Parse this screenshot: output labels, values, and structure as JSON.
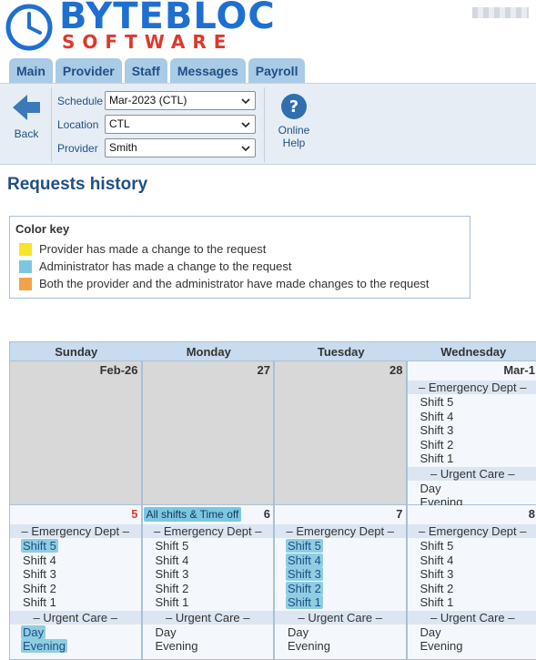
{
  "logo": {
    "top": "BYTEBLOC",
    "bottom": "SOFTWARE"
  },
  "tabs": [
    "Main",
    "Provider",
    "Staff",
    "Messages",
    "Payroll"
  ],
  "toolbar": {
    "back_label": "Back",
    "help_label_1": "Online",
    "help_label_2": "Help",
    "schedule_label": "Schedule",
    "schedule_value": "Mar-2023 (CTL)",
    "location_label": "Location",
    "location_value": "CTL",
    "provider_label": "Provider",
    "provider_value": "Smith"
  },
  "page_title": "Requests history",
  "color_key": {
    "title": "Color key",
    "items": [
      {
        "label": "Provider has made a change to the request",
        "color": "#f7e52a"
      },
      {
        "label": "Administrator has made a change to the request",
        "color": "#7cc7e0"
      },
      {
        "label": "Both the provider and the administrator have made changes to the request",
        "color": "#f4a24a"
      }
    ]
  },
  "calendar": {
    "days": [
      "Sunday",
      "Monday",
      "Tuesday",
      "Wednesday"
    ],
    "week1": [
      "Feb-26",
      "27",
      "28",
      "Mar-1"
    ],
    "week2": [
      "5",
      "6",
      "7",
      "8"
    ],
    "all_shifts_label": "All shifts & Time off",
    "sec_emergency": "– Emergency Dept –",
    "sec_urgent": "– Urgent Care –",
    "shifts": [
      "Shift 5",
      "Shift 4",
      "Shift 3",
      "Shift 2",
      "Shift 1"
    ],
    "urgent": [
      "Day",
      "Evening"
    ]
  },
  "colors": {
    "accent": "#1f4f86",
    "tab_bg": "#a9cbe6",
    "highlight": "#8fcde2"
  }
}
